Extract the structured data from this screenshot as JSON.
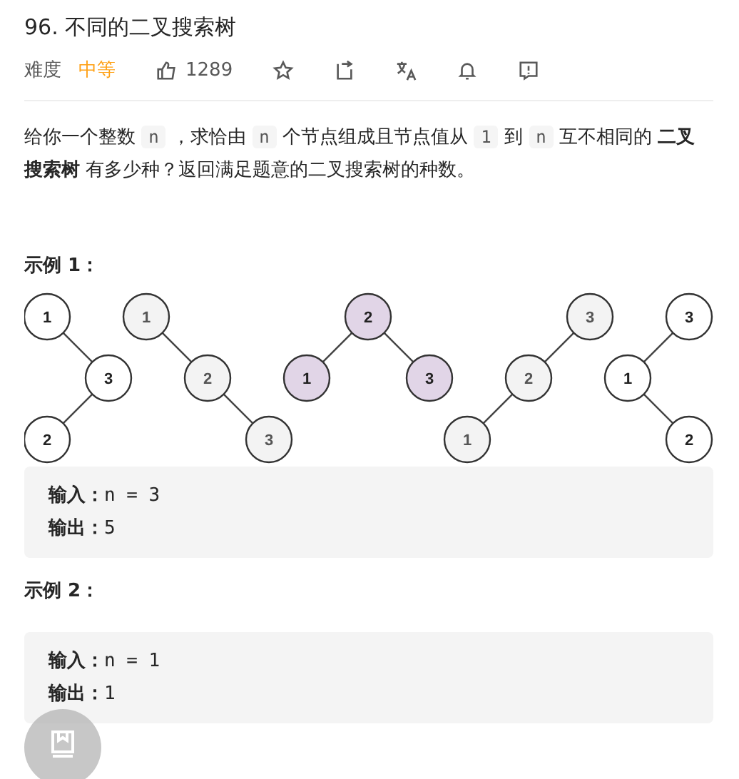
{
  "title": "96. 不同的二叉搜索树",
  "meta": {
    "difficulty_label": "难度",
    "difficulty": "中等",
    "likes": "1289"
  },
  "description": [
    {
      "kind": "text",
      "text": "给你一个整数 "
    },
    {
      "kind": "code",
      "text": "n"
    },
    {
      "kind": "text",
      "text": " ，求恰由 "
    },
    {
      "kind": "code",
      "text": "n"
    },
    {
      "kind": "text",
      "text": " 个节点组成且节点值从 "
    },
    {
      "kind": "code",
      "text": "1"
    },
    {
      "kind": "text",
      "text": " 到 "
    },
    {
      "kind": "code",
      "text": "n"
    },
    {
      "kind": "text",
      "text": " 互不相同的 "
    },
    {
      "kind": "bold",
      "text": "二叉搜索树"
    },
    {
      "kind": "text",
      "text": " 有多少种？返回满足题意的二叉搜索树的种数。"
    }
  ],
  "examples": [
    {
      "heading": "示例 1：",
      "trees": [
        {
          "color": "#ffffff",
          "root": {
            "label": "1",
            "children": [
              {
                "kind": "right",
                "label": "3",
                "children": [
                  {
                    "kind": "left",
                    "label": "2"
                  }
                ]
              }
            ]
          }
        },
        {
          "color": "#f3f3f3",
          "root": {
            "label": "1",
            "children": [
              {
                "kind": "right",
                "label": "2",
                "children": [
                  {
                    "kind": "right",
                    "label": "3"
                  }
                ]
              }
            ]
          }
        },
        {
          "color": "#e1d5e7",
          "root": {
            "label": "2",
            "children": [
              {
                "kind": "left",
                "label": "1"
              },
              {
                "kind": "right",
                "label": "3"
              }
            ]
          }
        },
        {
          "color": "#f3f3f3",
          "root": {
            "label": "3",
            "children": [
              {
                "kind": "left",
                "label": "2",
                "children": [
                  {
                    "kind": "left",
                    "label": "1"
                  }
                ]
              }
            ]
          }
        },
        {
          "color": "#ffffff",
          "root": {
            "label": "3",
            "children": [
              {
                "kind": "left",
                "label": "1",
                "children": [
                  {
                    "kind": "right",
                    "label": "2"
                  }
                ]
              }
            ]
          }
        }
      ],
      "lines": [
        {
          "label": "输入：",
          "value": "n = 3"
        },
        {
          "label": "输出：",
          "value": "5"
        }
      ]
    },
    {
      "heading": "示例 2：",
      "lines": [
        {
          "label": "输入：",
          "value": "n = 1"
        },
        {
          "label": "输出：",
          "value": "1"
        }
      ]
    }
  ]
}
